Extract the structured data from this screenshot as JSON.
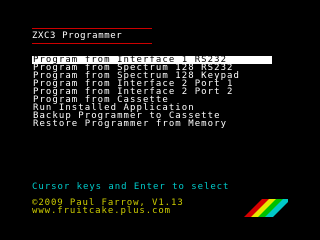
{
  "app": {
    "title": "ZXC3 Programmer"
  },
  "menu": {
    "items": [
      {
        "label": "Program from Interface 1 RS232",
        "selected": true
      },
      {
        "label": "Program from Spectrum 128 RS232",
        "selected": false
      },
      {
        "label": "Program from Spectrum 128 Keypad",
        "selected": false
      },
      {
        "label": "Program from Interface 2 Port 1",
        "selected": false
      },
      {
        "label": "Program from Interface 2 Port 2",
        "selected": false
      },
      {
        "label": "Program from Cassette",
        "selected": false
      },
      {
        "label": "Run Installed Application",
        "selected": false
      },
      {
        "label": "Backup Programmer to Cassette",
        "selected": false
      },
      {
        "label": "Restore Programmer from Memory",
        "selected": false
      }
    ]
  },
  "footer": {
    "hint": "Cursor keys and Enter to select",
    "credit": "©2009 Paul Farrow, V1.13",
    "url": "www.fruitcake.plus.com"
  },
  "colors": {
    "background": "#000000",
    "text": "#ffffff",
    "title_rule": "#cc0000",
    "hint": "#00cccc",
    "credit": "#cccc00",
    "stripe_red": "#d40000",
    "stripe_yellow": "#e8e800",
    "stripe_green": "#00c000",
    "stripe_cyan": "#00c8c8"
  },
  "icons": {
    "stripes": "zx-spectrum-rainbow-stripes-icon"
  }
}
